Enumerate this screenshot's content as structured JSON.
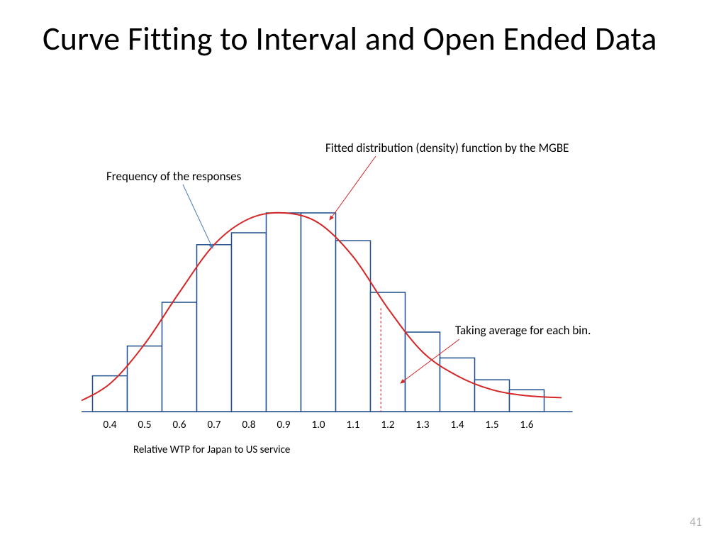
{
  "title": "Curve Fitting to Interval and Open Ended Data",
  "annotations": {
    "fitted": "Fitted distribution (density) function by the MGBE",
    "freq": "Frequency of the responses",
    "avg": "Taking average for each bin."
  },
  "page_number": "41",
  "chart_data": {
    "type": "bar",
    "categories": [
      "0.4",
      "0.5",
      "0.6",
      "0.7",
      "0.8",
      "0.9",
      "1.0",
      "1.1",
      "1.2",
      "1.3",
      "1.4",
      "1.5",
      "1.6"
    ],
    "values": [
      18,
      33,
      55,
      84,
      90,
      100,
      100,
      86,
      60,
      40,
      27,
      16,
      11
    ],
    "xlabel": "Relative WTP for Japan to US service",
    "ylabel": "",
    "ylim": [
      0,
      100
    ],
    "curve": {
      "type": "density",
      "xs": [
        0.3,
        0.4,
        0.5,
        0.6,
        0.7,
        0.8,
        0.9,
        1.0,
        1.1,
        1.2,
        1.3,
        1.4,
        1.5,
        1.6,
        1.7
      ],
      "ys": [
        4,
        14,
        34,
        60,
        84,
        97,
        100,
        95,
        78,
        52,
        30,
        18,
        11,
        8,
        7
      ]
    },
    "colors": {
      "bar_stroke": "#1f4e8c",
      "curve": "#d62728"
    }
  }
}
